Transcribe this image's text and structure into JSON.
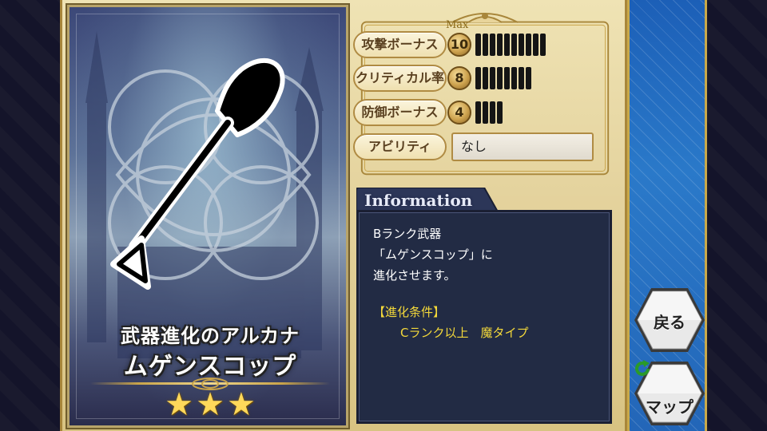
{
  "card": {
    "subtitle": "武器進化のアルカナ",
    "name": "ムゲンスコップ",
    "stars": [
      "★",
      "★",
      "★"
    ]
  },
  "stats": {
    "max_label": "Max",
    "rows": [
      {
        "label": "攻撃ボーナス",
        "value": "10",
        "level": 10
      },
      {
        "label": "クリティカル率",
        "value": "8",
        "level": 8
      },
      {
        "label": "防御ボーナス",
        "value": "4",
        "level": 4
      }
    ],
    "ability_label": "アビリティ",
    "ability_value": "なし"
  },
  "info": {
    "title": "Information",
    "lines": [
      "Bランク武器",
      "「ムゲンスコップ」に",
      "進化させます。",
      "【進化条件】",
      "Cランク以上　魔タイプ"
    ]
  },
  "buttons": {
    "back_label": "戻る",
    "map_label": "マップ"
  },
  "colors": {
    "frame_gold": "#e3d19b",
    "info_bg": "#222b44",
    "condition_text": "#f3d83a",
    "side_blue": "#2a79c9"
  },
  "icons": [
    "refresh-icon"
  ]
}
